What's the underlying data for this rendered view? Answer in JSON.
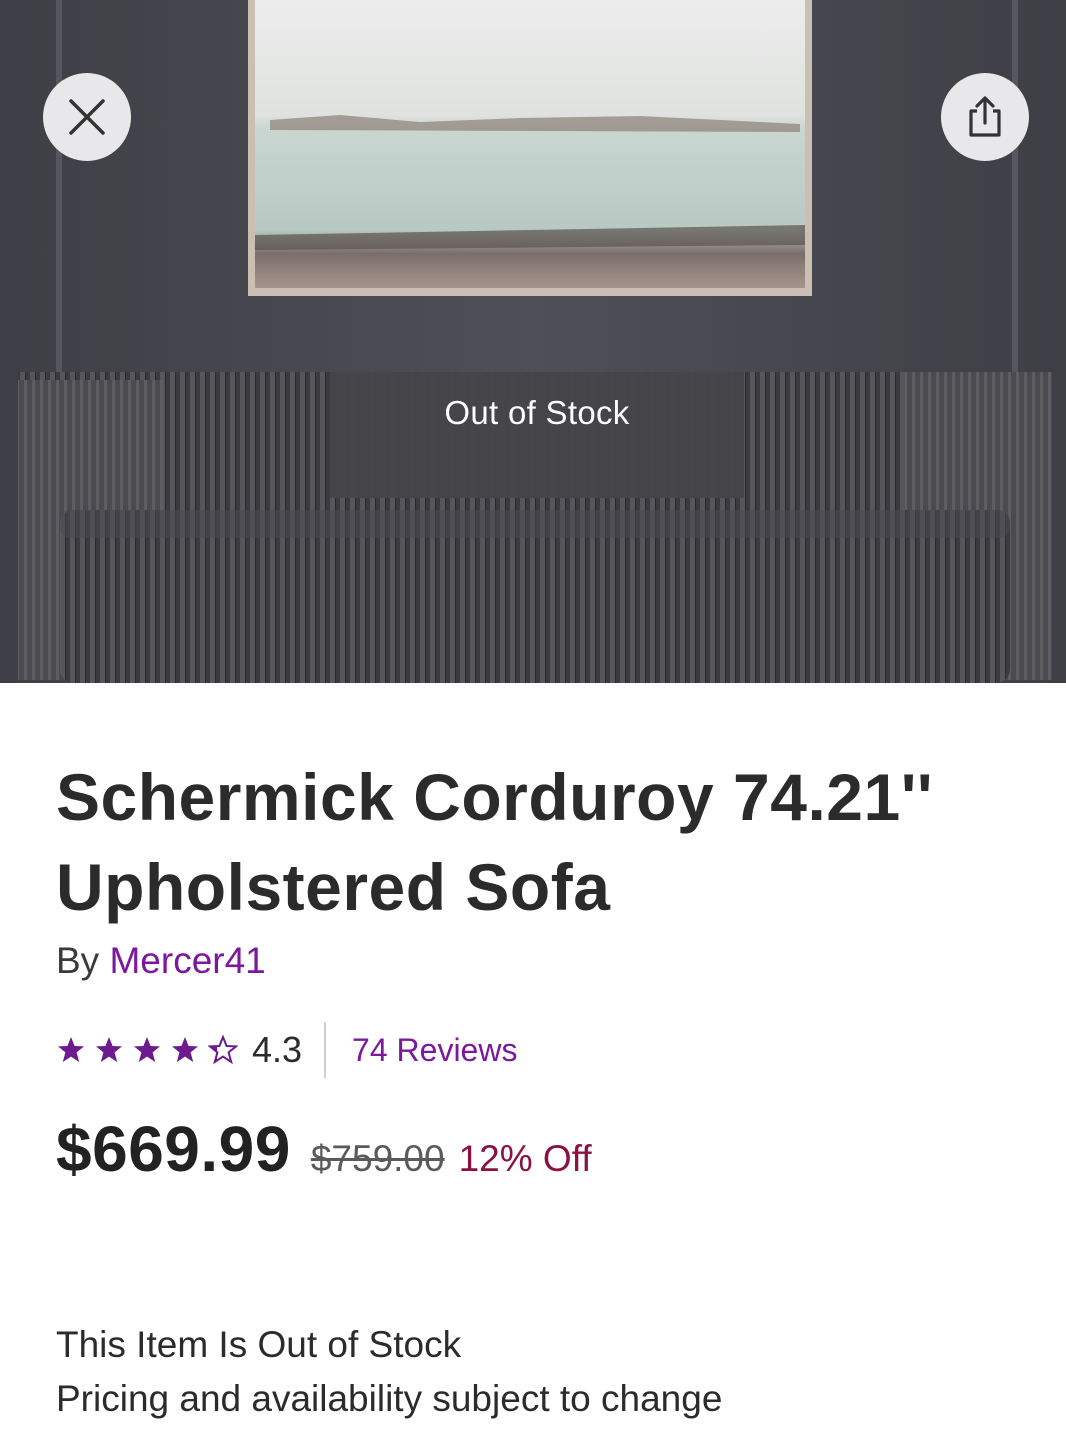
{
  "hero": {
    "overlay_text": "Out of Stock",
    "close_icon": "close-icon",
    "share_icon": "share-icon"
  },
  "product": {
    "title_line1": "Schermick Corduroy 74.21''",
    "title_line2": "Upholstered Sofa",
    "by_label": "By",
    "brand": "Mercer41",
    "rating": 4.3,
    "rating_text": "4.3",
    "reviews_text": "74 Reviews",
    "price": "$669.99",
    "original_price": "$759.00",
    "discount": "12% Off"
  },
  "stock": {
    "line1": "This Item Is Out of Stock",
    "line2": "Pricing and availability subject to change"
  },
  "colors": {
    "brand_purple": "#7b189f",
    "discount_red": "#8b1143",
    "star_purple": "#6d1a8f"
  }
}
